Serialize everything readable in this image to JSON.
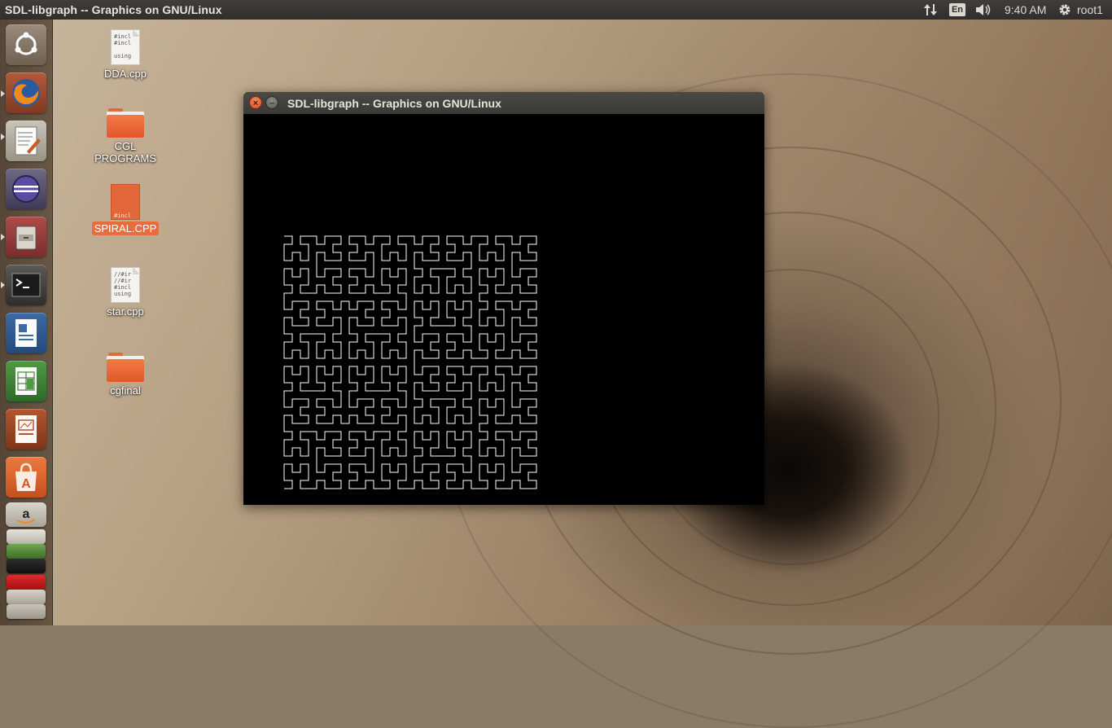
{
  "top_panel": {
    "title": "SDL-libgraph -- Graphics on GNU/Linux",
    "network_icon": "network-updown-icon",
    "language": "En",
    "volume_icon": "volume-icon",
    "time": "9:40 AM",
    "settings_icon": "gear-icon",
    "user": "root1"
  },
  "launcher": {
    "items": [
      {
        "name": "Dash",
        "icon": "ubuntu-dash-icon"
      },
      {
        "name": "Firefox",
        "icon": "firefox-icon"
      },
      {
        "name": "Text Editor",
        "icon": "text-editor-icon"
      },
      {
        "name": "Eclipse",
        "icon": "eclipse-icon"
      },
      {
        "name": "Files",
        "icon": "files-icon"
      },
      {
        "name": "Terminal",
        "icon": "terminal-icon"
      },
      {
        "name": "LibreOffice Writer",
        "icon": "writer-icon"
      },
      {
        "name": "LibreOffice Calc",
        "icon": "calc-icon"
      },
      {
        "name": "LibreOffice Impress",
        "icon": "impress-icon"
      },
      {
        "name": "Software Center",
        "icon": "software-center-icon"
      },
      {
        "name": "Amazon",
        "icon": "amazon-icon"
      }
    ]
  },
  "desktop": {
    "icons": [
      {
        "label": "DDA.cpp",
        "type": "cpp-file",
        "preview": "#incl\n#incl\n\nusing"
      },
      {
        "label": "CGL PROGRAMS",
        "type": "folder"
      },
      {
        "label": "SPIRAL.CPP",
        "type": "cpp-file-selected",
        "preview": "#incl"
      },
      {
        "label": "star.cpp",
        "type": "cpp-file",
        "preview": "//#ir\n//#ir\n#incl\nusing"
      },
      {
        "label": "cgfinal",
        "type": "folder"
      }
    ]
  },
  "window": {
    "title": "SDL-libgraph -- Graphics on GNU/Linux",
    "close_symbol": "×",
    "minimize_symbol": "–",
    "canvas": {
      "background": "#000000",
      "curve_color": "#ffffff",
      "curve": "Hilbert curve",
      "order": 5
    }
  }
}
